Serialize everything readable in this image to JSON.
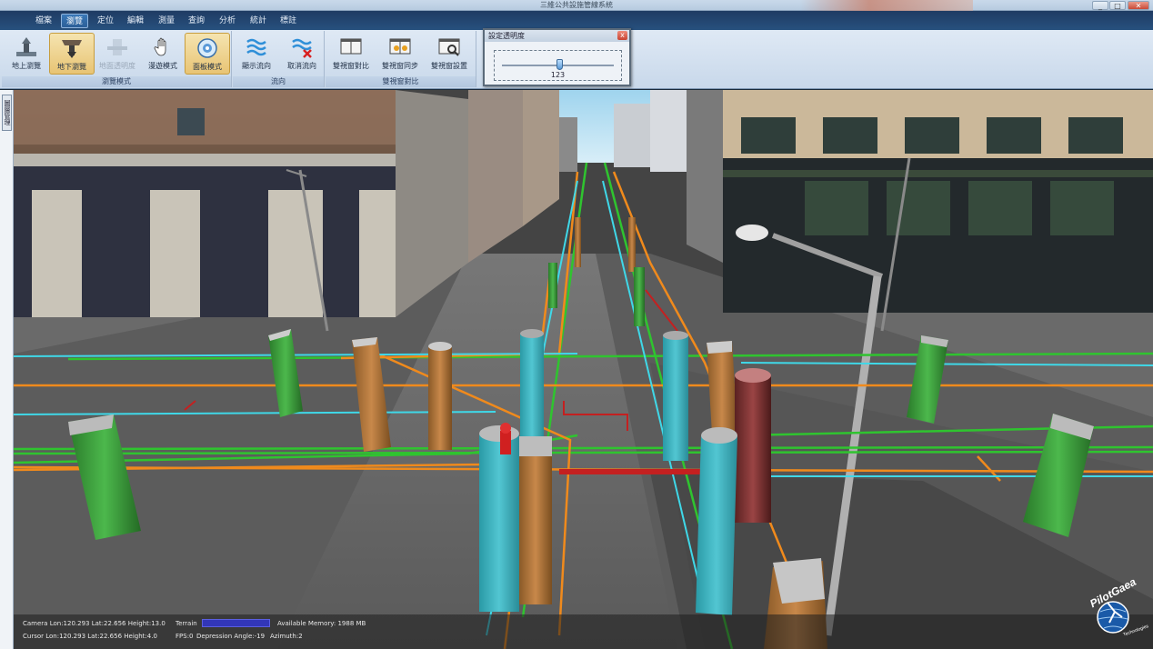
{
  "window": {
    "title": "三維公共設施管線系統",
    "controls": {
      "minimize": "_",
      "maximize": "□",
      "close": "✕"
    }
  },
  "menu": [
    {
      "label": "檔案",
      "active": false
    },
    {
      "label": "瀏覽",
      "active": true
    },
    {
      "label": "定位",
      "active": false
    },
    {
      "label": "編輯",
      "active": false
    },
    {
      "label": "測量",
      "active": false
    },
    {
      "label": "查詢",
      "active": false
    },
    {
      "label": "分析",
      "active": false
    },
    {
      "label": "統計",
      "active": false
    },
    {
      "label": "標註",
      "active": false
    }
  ],
  "ribbon": {
    "groups": [
      {
        "label": "瀏覽模式",
        "buttons": [
          {
            "label": "地上瀏覽",
            "icon": "surface-view-icon",
            "active": false,
            "disabled": false
          },
          {
            "label": "地下瀏覽",
            "icon": "underground-view-icon",
            "active": true,
            "disabled": false
          },
          {
            "label": "地面透明度",
            "icon": "ground-transparency-icon",
            "active": false,
            "disabled": true
          },
          {
            "label": "漫遊模式",
            "icon": "hand-pan-icon",
            "active": false,
            "disabled": false
          },
          {
            "label": "面板模式",
            "icon": "panel-mode-icon",
            "active": true,
            "disabled": false
          }
        ]
      },
      {
        "label": "流向",
        "buttons": [
          {
            "label": "顯示流向",
            "icon": "show-flow-icon",
            "active": false,
            "disabled": false
          },
          {
            "label": "取消流向",
            "icon": "cancel-flow-icon",
            "active": false,
            "disabled": false
          }
        ]
      },
      {
        "label": "雙視窗對比",
        "buttons": [
          {
            "label": "雙視窗對比",
            "icon": "dual-window-compare-icon",
            "active": false,
            "disabled": false
          },
          {
            "label": "雙視窗同步",
            "icon": "dual-window-sync-icon",
            "active": false,
            "disabled": false
          },
          {
            "label": "雙視窗設置",
            "icon": "dual-window-settings-icon",
            "active": false,
            "disabled": false
          }
        ]
      }
    ]
  },
  "transparency_dialog": {
    "title": "設定透明度",
    "value": "123",
    "close": "x"
  },
  "side_tab": {
    "label": "圖層管理"
  },
  "status": {
    "camera": "Camera Lon:120.293 Lat:22.656 Height:13.0",
    "cursor": "Cursor Lon:120.293 Lat:22.656 Height:4.0",
    "terrain_label": "Terrain",
    "memory": "Available Memory: 1988 MB",
    "fps": "FPS:0",
    "depression": "Depression Angle:-19",
    "azimuth": "Azimuth:2"
  },
  "logo": {
    "text": "PilotGaea",
    "subtext": "Technologies"
  },
  "colors": {
    "menubar": "#27507e",
    "ribbon": "#dfe9f5",
    "pipe_green": "#2fc42f",
    "pipe_orange": "#f08a1c",
    "pipe_cyan": "#3fd8e8",
    "pipe_red": "#c42020",
    "terrain_bar": "#3236b8"
  }
}
